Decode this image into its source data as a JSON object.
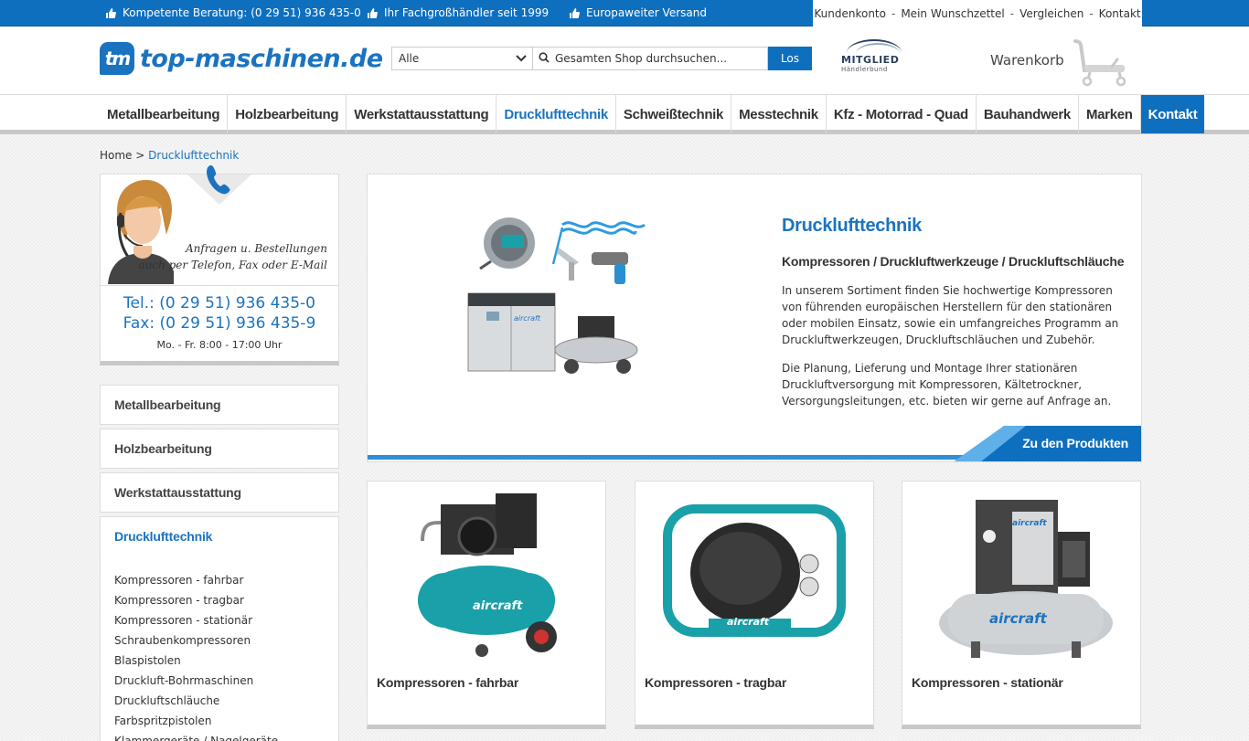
{
  "topbar": {
    "usps": [
      "Kompetente Beratung: (0 29 51) 936 435-0",
      "Ihr Fachgroßhändler seit 1999",
      "Europaweiter Versand"
    ],
    "links": [
      "Kundenkonto",
      "Mein Wunschzettel",
      "Vergleichen",
      "Kontakt"
    ],
    "separator": "-"
  },
  "header": {
    "logo_mark": "tm",
    "logo_text": "top-maschinen.de",
    "search": {
      "category": "Alle",
      "placeholder": "Gesamten Shop durchsuchen...",
      "button": "Los"
    },
    "member_title": "MITGLIED",
    "member_sub": "Händlerbund",
    "cart_label": "Warenkorb"
  },
  "nav": {
    "items": [
      "Metallbearbeitung",
      "Holzbearbeitung",
      "Werkstattausstattung",
      "Drucklufttechnik",
      "Schweißtechnik",
      "Messtechnik",
      "Kfz - Motorrad - Quad",
      "Bauhandwerk",
      "Marken",
      "Kontakt"
    ],
    "active": "Drucklufttechnik"
  },
  "breadcrumb": {
    "home": "Home",
    "sep": ">",
    "current": "Drucklufttechnik"
  },
  "contact": {
    "line1": "Anfragen u. Bestellungen",
    "line2": "auch per Telefon, Fax oder E-Mail",
    "tel": "Tel.: (0 29 51) 936 435-0",
    "fax": "Fax: (0 29 51) 936 435-9",
    "hours": "Mo. - Fr. 8:00 - 17:00 Uhr"
  },
  "sidebar": {
    "categories": [
      "Metallbearbeitung",
      "Holzbearbeitung",
      "Werkstattausstattung"
    ],
    "active": {
      "title": "Drucklufttechnik",
      "subitems": [
        "Kompressoren - fahrbar",
        "Kompressoren - tragbar",
        "Kompressoren - stationär",
        "Schraubenkompressoren",
        "Blaspistolen",
        "Druckluft-Bohrmaschinen",
        "Druckluftschläuche",
        "Farbspritzpistolen",
        "Klammergeräte / Nagelgeräte"
      ]
    }
  },
  "hero": {
    "title": "Drucklufttechnik",
    "subtitle": "Kompressoren / Druckluftwerkzeuge / Druckluftschläuche",
    "p1": "In unserem Sortiment finden Sie hochwertige Kompressoren von führenden europäischen Herstellern für den stationären oder mobilen Einsatz, sowie ein umfangreiches Programm an Druckluftwerkzeugen, Druckluftschläuchen und Zubehör.",
    "p2": "Die Planung, Lieferung und Montage Ihrer stationären Druckluftversorgung mit Kompressoren, Kältetrockner, Versorgungsleitungen, etc. bieten wir gerne auf Anfrage an.",
    "cta": "Zu den Produkten",
    "brand_text": "aircraft"
  },
  "products": [
    {
      "title": "Kompressoren - fahrbar",
      "brand": "aircraft"
    },
    {
      "title": "Kompressoren - tragbar",
      "brand": "aircraft"
    },
    {
      "title": "Kompressoren - stationär",
      "brand": "aircraft"
    }
  ],
  "colors": {
    "primary": "#0f6fbf",
    "accent_light": "#2f8fd5",
    "teal": "#1aa0a8"
  }
}
